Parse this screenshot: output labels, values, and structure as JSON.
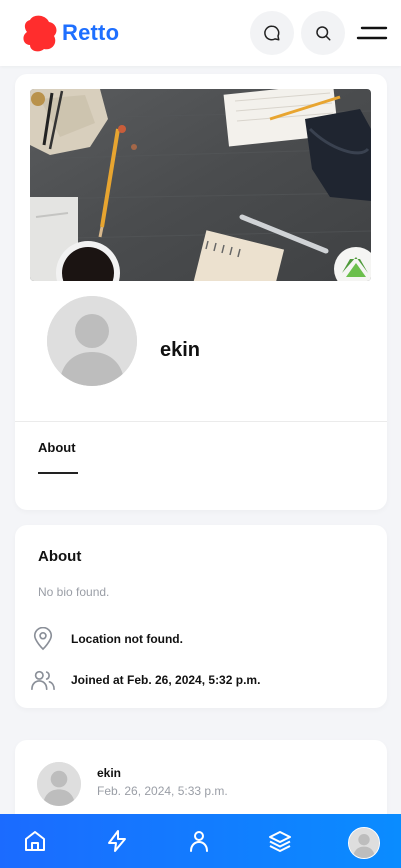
{
  "header": {
    "brand": "Retto",
    "icons": [
      "chat-icon",
      "search-icon",
      "menu-icon"
    ]
  },
  "profile": {
    "username": "ekin",
    "tabs": [
      {
        "label": "About",
        "active": true
      }
    ]
  },
  "about": {
    "title": "About",
    "bio": "No bio found.",
    "location": "Location not found.",
    "joined": "Joined at Feb. 26, 2024, 5:32 p.m."
  },
  "post": {
    "author": "ekin",
    "date": "Feb. 26, 2024, 5:33 p.m."
  },
  "bottom_nav": {
    "items": [
      "home-icon",
      "bolt-icon",
      "user-icon",
      "layers-icon",
      "avatar"
    ]
  },
  "colors": {
    "accent": "#1e6fff",
    "logo": "#ff2d2d",
    "nav_gradient_start": "#1b6bff",
    "nav_gradient_end": "#0a8cff"
  }
}
